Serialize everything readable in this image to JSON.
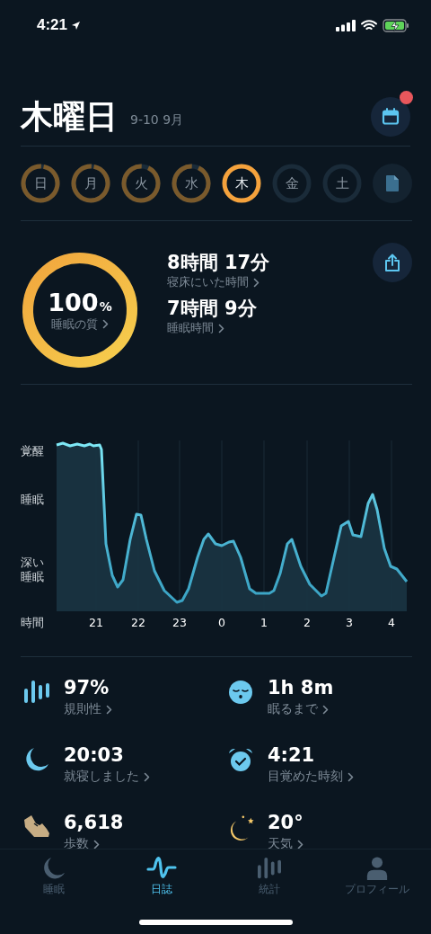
{
  "status_bar": {
    "time": "4:21"
  },
  "header": {
    "title": "木曜日",
    "date_range": "9-10 9月",
    "calendar_badge": true
  },
  "days": [
    {
      "label": "日",
      "level": 0.97,
      "selected": false
    },
    {
      "label": "月",
      "level": 0.97,
      "selected": false
    },
    {
      "label": "火",
      "level": 0.93,
      "selected": false
    },
    {
      "label": "水",
      "level": 0.93,
      "selected": false
    },
    {
      "label": "木",
      "level": 1,
      "selected": true
    },
    {
      "label": "金",
      "level": 0,
      "selected": false
    },
    {
      "label": "土",
      "level": 0,
      "selected": false
    }
  ],
  "summary": {
    "quality": {
      "value": "100",
      "unit": "%",
      "label": "睡眠の質",
      "level": 1
    },
    "metrics": [
      {
        "value": "8時間 17分",
        "label": "寝床にいた時間"
      },
      {
        "value": "7時間 9分",
        "label": "睡眠時間"
      }
    ]
  },
  "chart": {
    "y_labels": [
      "覚醒",
      "睡眠",
      "深い睡眠"
    ],
    "x_title": "時間",
    "hours": [
      "21",
      "22",
      "23",
      "0",
      "1",
      "2",
      "3",
      "4"
    ]
  },
  "stats": [
    {
      "value": "97%",
      "label": "規則性"
    },
    {
      "value": "1h 8m",
      "label": "眠るまで"
    },
    {
      "value": "20:03",
      "label": "就寝しました"
    },
    {
      "value": "4:21",
      "label": "目覚めた時刻"
    },
    {
      "value": "6,618",
      "label": "歩数"
    },
    {
      "value": "20°",
      "label": "天気"
    }
  ],
  "tabs": [
    {
      "label": "睡眠",
      "selected": false
    },
    {
      "label": "日誌",
      "selected": true
    },
    {
      "label": "統計",
      "selected": false
    },
    {
      "label": "プロフィール",
      "selected": false
    }
  ]
}
